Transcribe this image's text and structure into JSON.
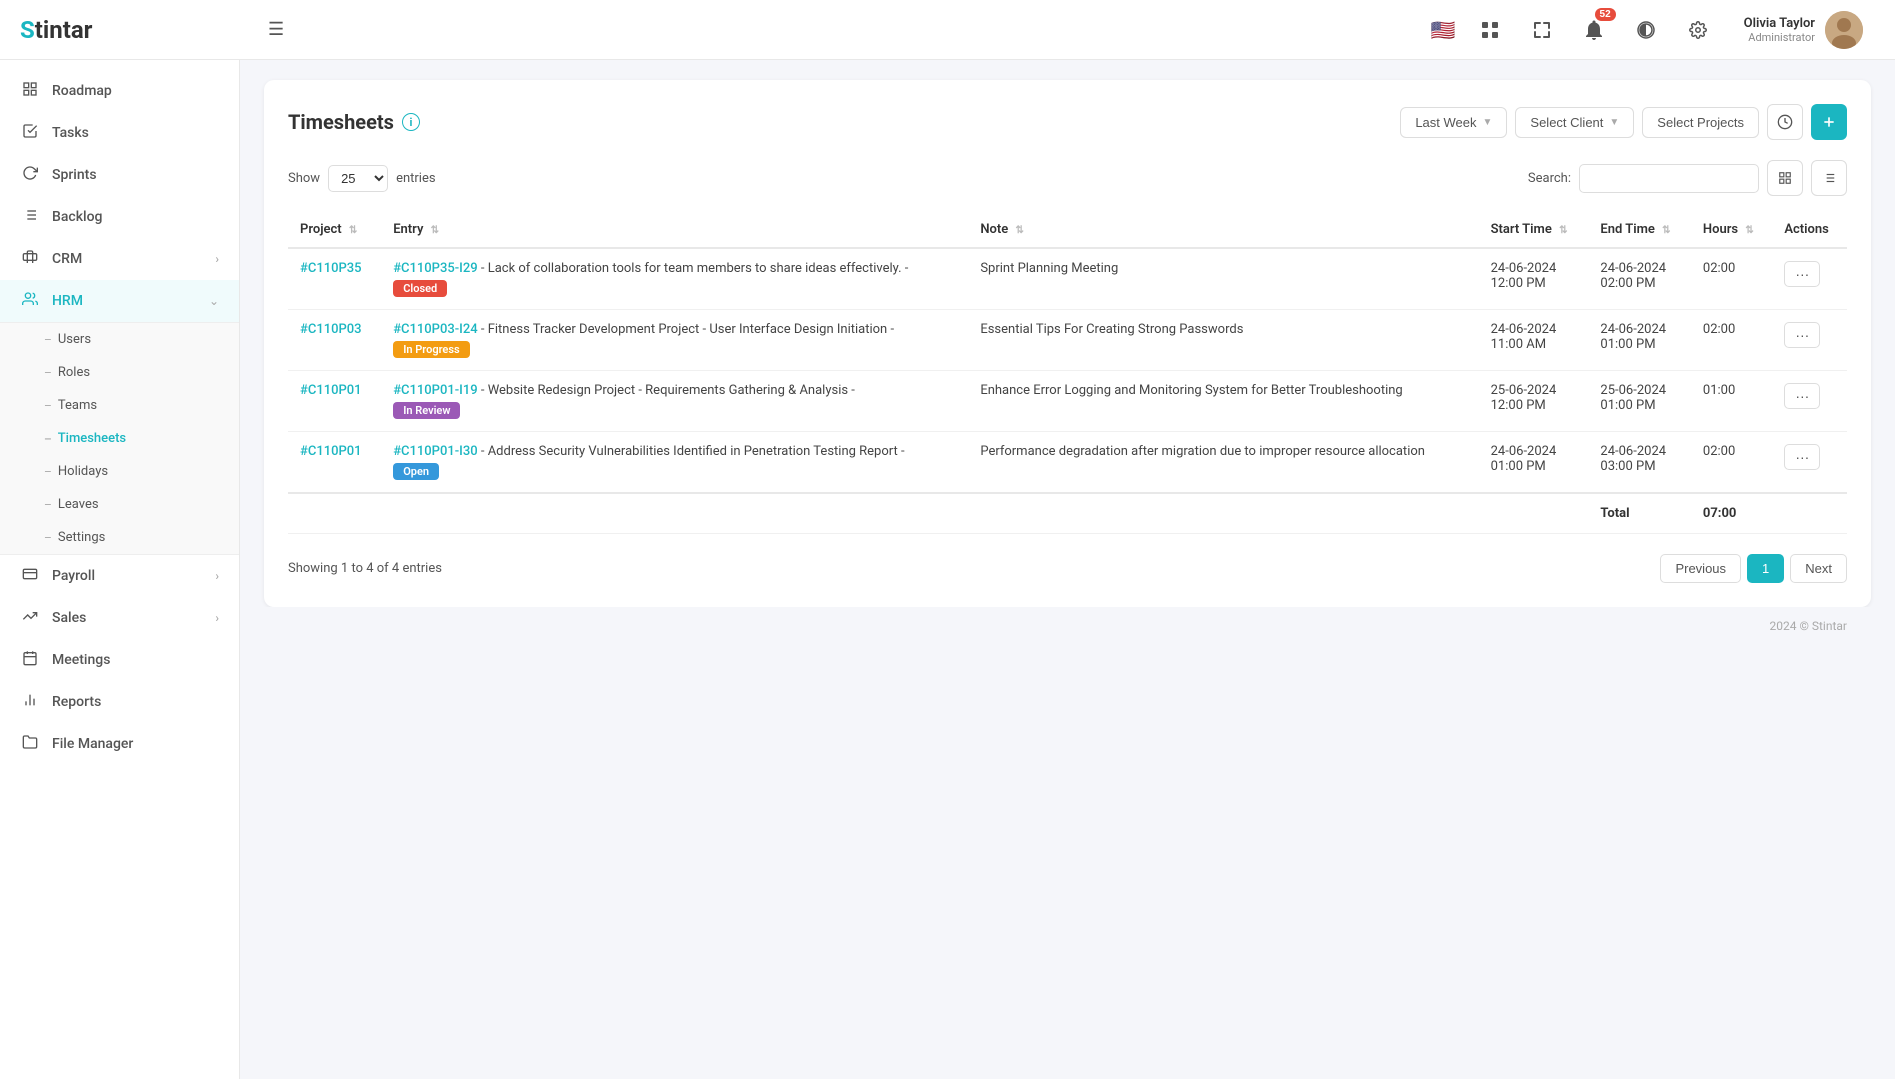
{
  "app": {
    "logo": "Stintar",
    "favicon": "S"
  },
  "header": {
    "hamburger_label": "☰",
    "notification_count": "52",
    "user": {
      "name": "Olivia Taylor",
      "role": "Administrator"
    },
    "icons": {
      "apps": "⊞",
      "expand": "⤢",
      "bell": "🔔",
      "moon": "🌙",
      "settings": "⚙"
    }
  },
  "sidebar": {
    "items": [
      {
        "id": "roadmap",
        "label": "Roadmap",
        "icon": "📊",
        "has_arrow": false
      },
      {
        "id": "tasks",
        "label": "Tasks",
        "icon": "☑",
        "has_arrow": false
      },
      {
        "id": "sprints",
        "label": "Sprints",
        "icon": "🔄",
        "has_arrow": false
      },
      {
        "id": "backlog",
        "label": "Backlog",
        "icon": "📋",
        "has_arrow": false
      },
      {
        "id": "crm",
        "label": "CRM",
        "icon": "💼",
        "has_arrow": true
      },
      {
        "id": "hrm",
        "label": "HRM",
        "icon": "👥",
        "has_arrow": true,
        "active": true
      },
      {
        "id": "payroll",
        "label": "Payroll",
        "icon": "💰",
        "has_arrow": true
      },
      {
        "id": "sales",
        "label": "Sales",
        "icon": "📈",
        "has_arrow": true
      },
      {
        "id": "meetings",
        "label": "Meetings",
        "icon": "📅",
        "has_arrow": false
      },
      {
        "id": "reports",
        "label": "Reports",
        "icon": "📊",
        "has_arrow": false
      },
      {
        "id": "file-manager",
        "label": "File Manager",
        "icon": "📁",
        "has_arrow": false
      }
    ],
    "hrm_sub_items": [
      {
        "id": "users",
        "label": "Users"
      },
      {
        "id": "roles",
        "label": "Roles"
      },
      {
        "id": "teams",
        "label": "Teams"
      },
      {
        "id": "timesheets",
        "label": "Timesheets",
        "active": true
      },
      {
        "id": "holidays",
        "label": "Holidays"
      },
      {
        "id": "leaves",
        "label": "Leaves"
      },
      {
        "id": "settings",
        "label": "Settings"
      }
    ]
  },
  "timesheets": {
    "title": "Timesheets",
    "show_label": "Show",
    "entries_label": "entries",
    "entries_value": "25",
    "search_label": "Search:",
    "search_placeholder": "",
    "filters": {
      "period": "Last Week",
      "client": "Select Client",
      "projects": "Select Projects"
    },
    "columns": {
      "project": "Project",
      "entry": "Entry",
      "note": "Note",
      "start_time": "Start Time",
      "end_time": "End Time",
      "hours": "Hours",
      "actions": "Actions"
    },
    "rows": [
      {
        "project_id": "#C110P35",
        "entry_id": "#C110P35-I29",
        "entry_text": "- Lack of collaboration tools for team members to share ideas effectively. -",
        "status": "Closed",
        "status_class": "badge-closed",
        "note": "Sprint Planning Meeting",
        "start_date": "24-06-2024",
        "start_time": "12:00 PM",
        "end_date": "24-06-2024",
        "end_time": "02:00 PM",
        "hours": "02:00"
      },
      {
        "project_id": "#C110P03",
        "entry_id": "#C110P03-I24",
        "entry_text": "- Fitness Tracker Development Project - User Interface Design Initiation -",
        "status": "In Progress",
        "status_class": "badge-in-progress",
        "note": "Essential Tips For Creating Strong Passwords",
        "start_date": "24-06-2024",
        "start_time": "11:00 AM",
        "end_date": "24-06-2024",
        "end_time": "01:00 PM",
        "hours": "02:00"
      },
      {
        "project_id": "#C110P01",
        "entry_id": "#C110P01-I19",
        "entry_text": "- Website Redesign Project - Requirements Gathering & Analysis -",
        "status": "In Review",
        "status_class": "badge-in-review",
        "note": "Enhance Error Logging and Monitoring System for Better Troubleshooting",
        "start_date": "25-06-2024",
        "start_time": "12:00 PM",
        "end_date": "25-06-2024",
        "end_time": "01:00 PM",
        "hours": "01:00"
      },
      {
        "project_id": "#C110P01",
        "entry_id": "#C110P01-I30",
        "entry_text": "- Address Security Vulnerabilities Identified in Penetration Testing Report -",
        "status": "Open",
        "status_class": "badge-open",
        "note": "Performance degradation after migration due to improper resource allocation",
        "start_date": "24-06-2024",
        "start_time": "01:00 PM",
        "end_date": "24-06-2024",
        "end_time": "03:00 PM",
        "hours": "02:00"
      }
    ],
    "total_label": "Total",
    "total_hours": "07:00",
    "showing_text": "Showing 1 to 4 of 4 entries",
    "pagination": {
      "previous": "Previous",
      "next": "Next",
      "current_page": "1"
    }
  },
  "footer": {
    "copyright": "2024 © Stintar"
  }
}
